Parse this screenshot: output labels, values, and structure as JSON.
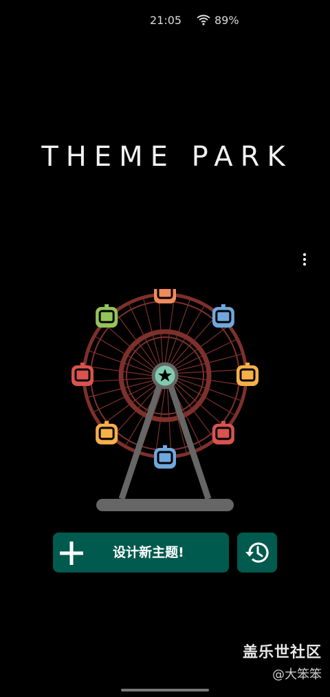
{
  "status_bar": {
    "time": "21:05",
    "battery": "89%",
    "wifi_icon": "wifi-icon"
  },
  "app": {
    "title": "THEME PARK",
    "more_icon": "more-vertical-icon"
  },
  "illustration": {
    "name": "ferris-wheel",
    "hub_icon": "star-icon",
    "colors": {
      "rim": "#7e302b",
      "frame": "#666666",
      "hub": "#7fcbb0",
      "cabins": [
        "#f08a5d",
        "#6fa8dc",
        "#f6b04a",
        "#d9534f",
        "#6fa8dc",
        "#f6b04a",
        "#d9534f",
        "#93c45a"
      ]
    }
  },
  "actions": {
    "new_theme_label": "设计新主题!",
    "new_theme_icon": "plus-icon",
    "history_icon": "history-icon",
    "button_color": "#015a4e"
  },
  "watermark": {
    "main": "盖乐世社区",
    "sub": "@大笨笨"
  }
}
